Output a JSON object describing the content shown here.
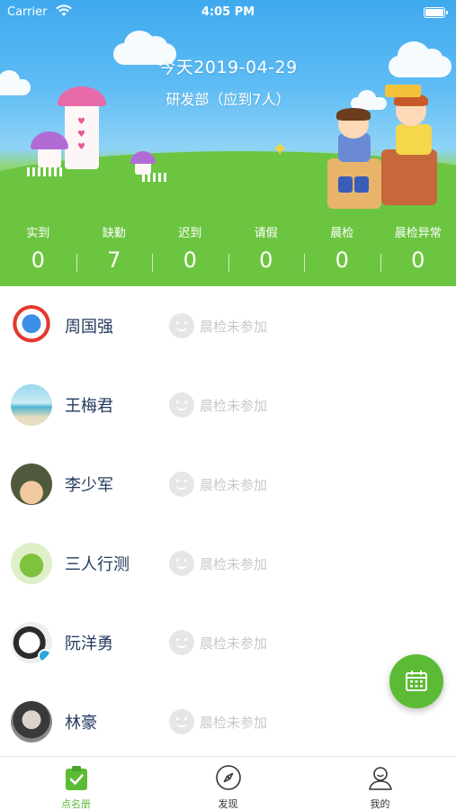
{
  "status_bar": {
    "carrier": "Carrier",
    "time": "4:05 PM"
  },
  "header": {
    "date_title": "今天2019-04-29",
    "department": "研发部（应到7人）"
  },
  "stats": [
    {
      "label": "实到",
      "value": "0"
    },
    {
      "label": "缺勤",
      "value": "7"
    },
    {
      "label": "迟到",
      "value": "0"
    },
    {
      "label": "请假",
      "value": "0"
    },
    {
      "label": "晨检",
      "value": "0"
    },
    {
      "label": "晨检异常",
      "value": "0"
    }
  ],
  "members": [
    {
      "name": "周国强",
      "status": "晨检未参加",
      "avatar": "superman-doraemon-avatar"
    },
    {
      "name": "王梅君",
      "status": "晨检未参加",
      "avatar": "beach-avatar"
    },
    {
      "name": "李少军",
      "status": "晨检未参加",
      "avatar": "soldier-avatar"
    },
    {
      "name": "三人行测",
      "status": "晨检未参加",
      "avatar": "green-fruit-avatar"
    },
    {
      "name": "阮洋勇",
      "status": "晨检未参加",
      "avatar": "cartoon-boy-avatar"
    },
    {
      "name": "林豪",
      "status": "晨检未参加",
      "avatar": "portrait-avatar"
    }
  ],
  "tabbar": {
    "items": [
      {
        "label": "点名册",
        "icon": "clipboard-check-icon",
        "active": true
      },
      {
        "label": "发现",
        "icon": "compass-icon",
        "active": false
      },
      {
        "label": "我的",
        "icon": "person-icon",
        "active": false
      }
    ]
  },
  "colors": {
    "accent": "#5cbb35",
    "name_text": "#233a5e",
    "muted": "#c8c8c8"
  }
}
